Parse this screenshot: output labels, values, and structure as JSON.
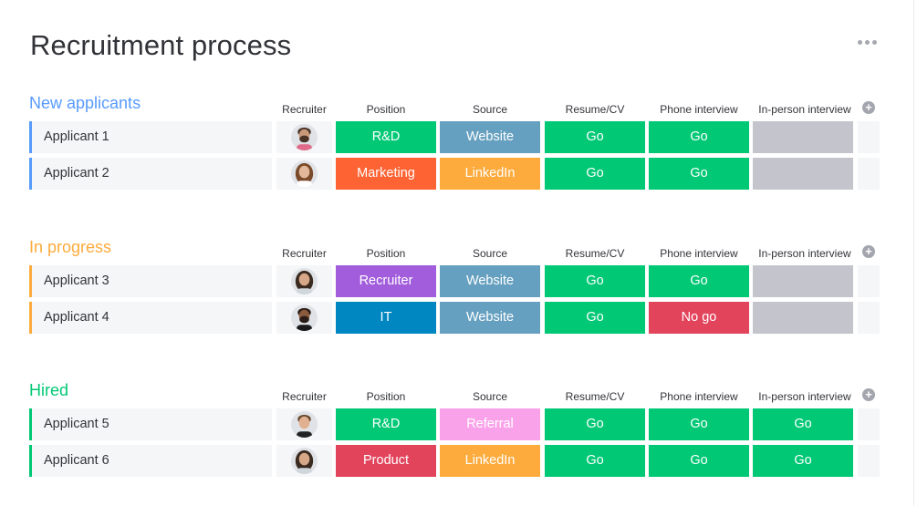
{
  "page": {
    "title": "Recruitment process",
    "more_icon": "more-horizontal-icon"
  },
  "columns": {
    "recruiter": "Recruiter",
    "position": "Position",
    "source": "Source",
    "resume": "Resume/CV",
    "phone": "Phone interview",
    "in_person": "In-person interview",
    "add_icon": "plus-circle-icon"
  },
  "colors": {
    "go": "#00c875",
    "no_go": "#e2445c",
    "empty": "#c4c4cc",
    "rnd": "#00c875",
    "marketing": "#fd6333",
    "recruiter": "#a25ddc",
    "it": "#0086c0",
    "product": "#e2445c",
    "website": "#66a0c0",
    "linkedin": "#fdab3d",
    "referral": "#f9a2ea"
  },
  "groups": [
    {
      "title": "New applicants",
      "color": "#579bfc",
      "rows": [
        {
          "name": "Applicant 1",
          "position": "R&D",
          "position_color": "#00c875",
          "source": "Website",
          "source_color": "#66a0c0",
          "resume": "Go",
          "resume_color": "#00c875",
          "phone": "Go",
          "phone_color": "#00c875",
          "in_person": "",
          "in_person_color": "#c4c4cc",
          "avatar": "man-beard"
        },
        {
          "name": "Applicant 2",
          "position": "Marketing",
          "position_color": "#fd6333",
          "source": "LinkedIn",
          "source_color": "#fdab3d",
          "resume": "Go",
          "resume_color": "#00c875",
          "phone": "Go",
          "phone_color": "#00c875",
          "in_person": "",
          "in_person_color": "#c4c4cc",
          "avatar": "woman-curly"
        }
      ]
    },
    {
      "title": "In progress",
      "color": "#fdab3d",
      "rows": [
        {
          "name": "Applicant 3",
          "position": "Recruiter",
          "position_color": "#a25ddc",
          "source": "Website",
          "source_color": "#66a0c0",
          "resume": "Go",
          "resume_color": "#00c875",
          "phone": "Go",
          "phone_color": "#00c875",
          "in_person": "",
          "in_person_color": "#c4c4cc",
          "avatar": "woman-long"
        },
        {
          "name": "Applicant 4",
          "position": "IT",
          "position_color": "#0086c0",
          "source": "Website",
          "source_color": "#66a0c0",
          "resume": "Go",
          "resume_color": "#00c875",
          "phone": "No go",
          "phone_color": "#e2445c",
          "in_person": "",
          "in_person_color": "#c4c4cc",
          "avatar": "man-bald"
        }
      ]
    },
    {
      "title": "Hired",
      "color": "#00c875",
      "rows": [
        {
          "name": "Applicant 5",
          "position": "R&D",
          "position_color": "#00c875",
          "source": "Referral",
          "source_color": "#f9a2ea",
          "resume": "Go",
          "resume_color": "#00c875",
          "phone": "Go",
          "phone_color": "#00c875",
          "in_person": "Go",
          "in_person_color": "#00c875",
          "avatar": "man-short"
        },
        {
          "name": "Applicant 6",
          "position": "Product",
          "position_color": "#e2445c",
          "source": "LinkedIn",
          "source_color": "#fdab3d",
          "resume": "Go",
          "resume_color": "#00c875",
          "phone": "Go",
          "phone_color": "#00c875",
          "in_person": "Go",
          "in_person_color": "#00c875",
          "avatar": "woman-long"
        }
      ]
    }
  ]
}
